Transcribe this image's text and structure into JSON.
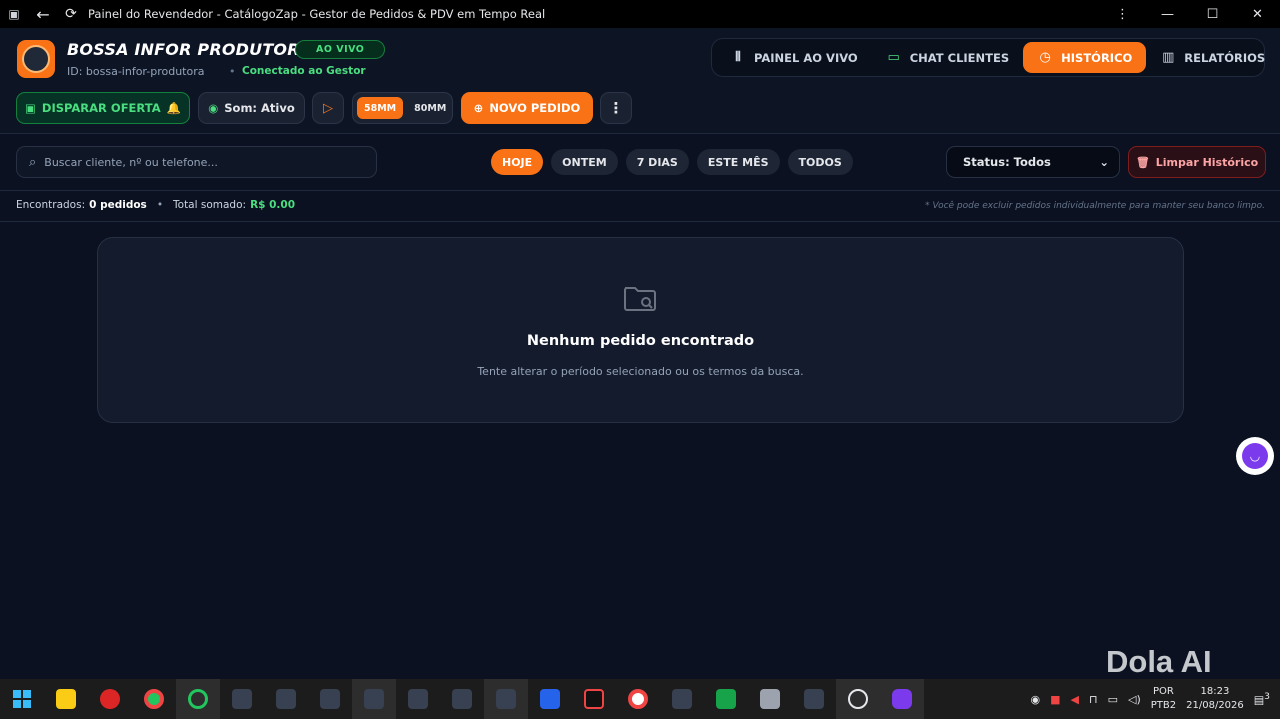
{
  "window": {
    "title": "Painel do Revendedor - CatálogoZap - Gestor de Pedidos & PDV em Tempo Real"
  },
  "header": {
    "brand": "BOSSA INFOR PRODUTORA",
    "live_badge": "AO VIVO",
    "store_id": "ID: bossa-infor-produtora",
    "separator": "•",
    "connection_status": "Conectado ao Gestor"
  },
  "nav": {
    "items": [
      {
        "label": "PAINEL AO VIVO",
        "icon": "radio-icon"
      },
      {
        "label": "CHAT CLIENTES",
        "icon": "chat-icon"
      },
      {
        "label": "HISTÓRICO",
        "icon": "history-icon",
        "active": true
      },
      {
        "label": "RELATÓRIOS",
        "icon": "bar-chart-icon"
      }
    ]
  },
  "toolbar": {
    "offer_label": "DISPARAR OFERTA",
    "sound_label": "Som: Ativo",
    "paper_58": "58MM",
    "paper_80": "80MM",
    "new_order_label": "NOVO PEDIDO"
  },
  "filters": {
    "search_placeholder": "Buscar cliente, nº ou telefone...",
    "periods": [
      "HOJE",
      "ONTEM",
      "7 DIAS",
      "ESTE MÊS",
      "TODOS"
    ],
    "active_period": "HOJE",
    "status_value": "Status: Todos",
    "clear_label": "Limpar Histórico"
  },
  "summary": {
    "found_label": "Encontrados:",
    "found_value": "0 pedidos",
    "separator": "•",
    "total_label": "Total somado:",
    "total_value": "R$ 0.00",
    "hint": "* Você pode excluir pedidos individualmente para manter seu banco limpo."
  },
  "empty_state": {
    "title": "Nenhum pedido encontrado",
    "subtitle": "Tente alterar o período selecionado ou os termos da busca."
  },
  "watermark": "Dola AI",
  "taskbar": {
    "lang_line1": "POR",
    "lang_line2": "PTB2",
    "time": "18:23",
    "date": "21/08/2026",
    "notifications": "3"
  },
  "colors": {
    "accent": "#f97316",
    "success": "#4ade80",
    "danger": "#fca5a5",
    "background": "#0b1120"
  }
}
